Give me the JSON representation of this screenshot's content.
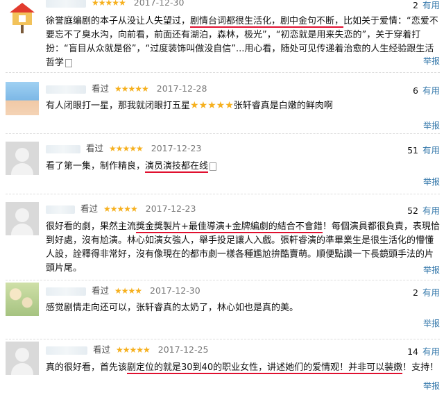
{
  "reviews": [
    {
      "avatar": "house-icon",
      "watched": "",
      "stars_display": "★★★★★",
      "date": "2017-12-30",
      "useful_count": "2",
      "useful_label": "有用",
      "text_parts": [
        "徐誉庭编剧的本子从没让人失望过，",
        "剧情台词都很生活化，剧中金句不断，",
        "比如关于爱情：“恋爱不要忘不了臭水沟，向前看，前面还有湖泊，森林，极光”，“初恋就是用来失恋的”，关于穿着打扮：“盲目从众就是俗”，“过度装饰叫做没自信”...用心看，随处可见传递着治愈的人生经验跟生活哲学"
      ],
      "report": "举报"
    },
    {
      "avatar": "photo",
      "watched": "看过",
      "stars_display": "★★★★★",
      "date": "2017-12-28",
      "useful_count": "6",
      "useful_label": "有用",
      "text_parts": [
        "有人闭眼打一星，那我就闭眼打五星",
        "★★★★★",
        "张轩睿真是白嫩的鲜肉啊"
      ],
      "report": "举报"
    },
    {
      "avatar": "gray",
      "watched": "看过",
      "stars_display": "★★★★★",
      "date": "2017-12-23",
      "useful_count": "51",
      "useful_label": "有用",
      "text_parts": [
        "看了第一集，制作精良，",
        "演员演技都在线"
      ],
      "report": "举报"
    },
    {
      "avatar": "gray",
      "watched": "看过",
      "stars_display": "★★★★★",
      "date": "2017-12-23",
      "useful_count": "52",
      "useful_label": "有用",
      "text_parts": [
        "很好看的劇，果然主流",
        "獎金獎製片+最佳導演+金牌編劇的結合不會錯",
        "！每個演員都很負責，表現恰到好處，沒有尬演。林心如演女強人，舉手投足讓人入戲。張軒睿演的準畢業生是很生活化的懵懂人設，詮釋得非常好，沒有像現在的都市劇一樣各種尷尬拚酷賣萌。順便點讚一下長鏡頭手法的片頭片尾。"
      ],
      "report": "举报"
    },
    {
      "avatar": "flower",
      "watched": "看过",
      "stars_display": "★★★★",
      "date": "2017-12-30",
      "useful_count": "2",
      "useful_label": "有用",
      "text_parts": [
        "感觉剧情走向还可以，张轩睿真的太奶了，林心如也是真的美。"
      ],
      "report": "举报"
    },
    {
      "avatar": "gray",
      "watched": "看过",
      "stars_display": "★★★★★",
      "date": "2017-12-25",
      "useful_count": "14",
      "useful_label": "有用",
      "text_parts": [
        "真的很好看，首先该",
        "剧定位的就是30到40的职业女性，讲述她们的爱情观！并非可以装嫩",
        "！支持！"
      ],
      "report": "举报"
    }
  ]
}
